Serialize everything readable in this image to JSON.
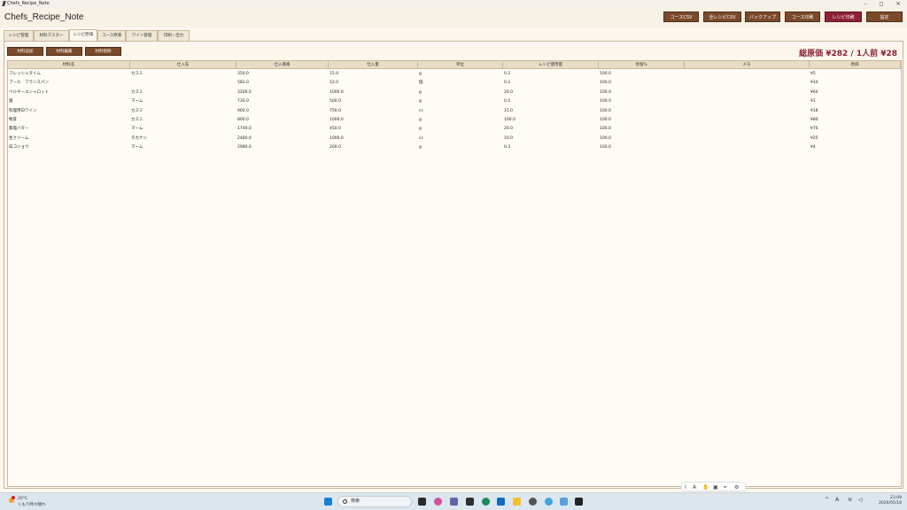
{
  "window": {
    "title": "Chefs_Recipe_Note",
    "minimize": "–",
    "maximize": "◻",
    "close": "✕"
  },
  "app": {
    "title": "Chefs_Recipe_Note",
    "header_buttons": [
      "コースCSV",
      "全レシピCSV",
      "バックアップ",
      "コース印刷",
      "レシピ印刷",
      "設定"
    ]
  },
  "tabs": [
    "レシピ管理",
    "材料マスター",
    "レシピ原価",
    "コース原価",
    "ワイン管理",
    "印刷・出力"
  ],
  "active_tab": "レシピ原価",
  "actions": [
    "材料追加",
    "材料編集",
    "材料削除"
  ],
  "total": "総原価 ¥282 / 1人前 ¥28",
  "table": {
    "headers": [
      "材料名",
      "仕入先",
      "仕入価格",
      "仕入量",
      "単位",
      "レシピ使用量",
      "歩留%",
      "メモ",
      "原価"
    ],
    "rows": [
      [
        "フレッシュタイム",
        "カスミ",
        "350.0",
        "15.0",
        "g",
        "0.2",
        "100.0",
        "",
        "¥5"
      ],
      [
        "ブール　フランスパン",
        "",
        "582.0",
        "12.0",
        "個",
        "0.2",
        "100.0",
        "",
        "¥10"
      ],
      [
        "ベルギーエシャロット",
        "カスミ",
        "3200.0",
        "1000.0",
        "g",
        "20.0",
        "100.0",
        "",
        "¥64"
      ],
      [
        "塩",
        "マーム",
        "730.0",
        "500.0",
        "g",
        "0.5",
        "100.0",
        "",
        "¥1"
      ],
      [
        "料理用白ワイン",
        "カスミ",
        "900.0",
        "750.0",
        "cc",
        "15.0",
        "100.0",
        "",
        "¥18"
      ],
      [
        "牧茸",
        "カスミ",
        "800.0",
        "1000.0",
        "g",
        "100.0",
        "100.0",
        "",
        "¥80"
      ],
      [
        "無塩バター",
        "マーム",
        "1700.0",
        "450.0",
        "g",
        "20.0",
        "100.0",
        "",
        "¥76"
      ],
      [
        "生クリーム",
        "タカナシ",
        "2480.0",
        "1000.0",
        "cc",
        "10.0",
        "100.0",
        "",
        "¥25"
      ],
      [
        "白コショウ",
        "マーム",
        "2980.0",
        "200.0",
        "g",
        "0.3",
        "100.0",
        "",
        "¥4"
      ]
    ]
  },
  "floating_toolbar": [
    "I",
    "A",
    "✋",
    "▣",
    "⌖",
    "⚙"
  ],
  "taskbar": {
    "temperature": "20°C",
    "weather": "くもり時々晴れ",
    "search_placeholder": "検索",
    "time": "23:09",
    "date": "2026/05/18"
  }
}
